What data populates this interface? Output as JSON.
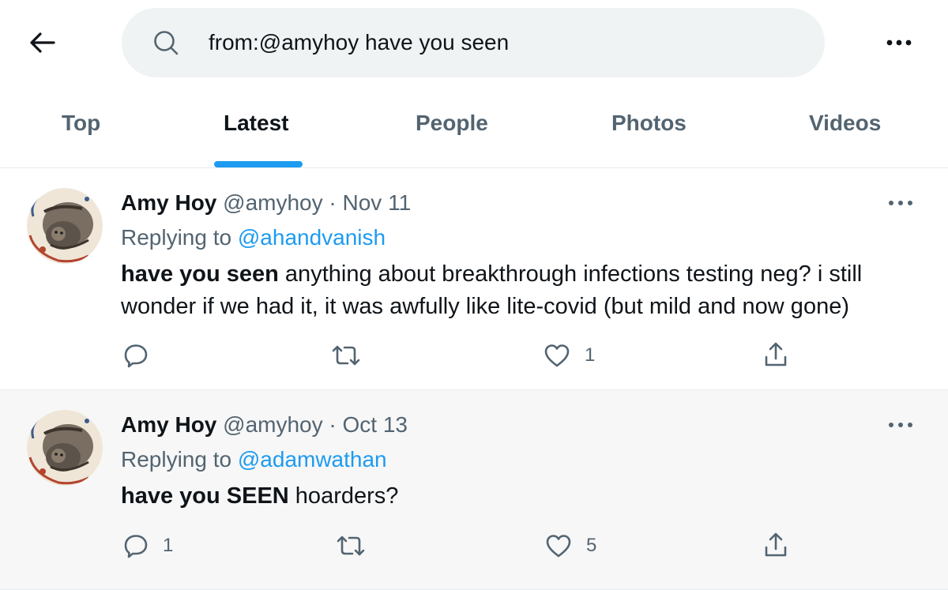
{
  "search": {
    "query": "from:@amyhoy have you seen",
    "back_icon": "arrow-left-icon",
    "search_icon": "magnifier-icon",
    "more_icon": "ellipsis-icon"
  },
  "tabs": [
    {
      "label": "Top",
      "active": false
    },
    {
      "label": "Latest",
      "active": true
    },
    {
      "label": "People",
      "active": false
    },
    {
      "label": "Photos",
      "active": false
    },
    {
      "label": "Videos",
      "active": false
    }
  ],
  "tweets": [
    {
      "name": "Amy Hoy",
      "handle": "@amyhoy",
      "separator": "·",
      "date": "Nov 11",
      "replying_prefix": "Replying to",
      "replying_to": "@ahandvanish",
      "text_bold": "have you seen",
      "text_rest": " anything about breakthrough infections testing neg? i still wonder if we had it, it was awfully like lite-covid (but mild and now gone)",
      "reply_count": "",
      "retweet_count": "",
      "like_count": "1"
    },
    {
      "name": "Amy Hoy",
      "handle": "@amyhoy",
      "separator": "·",
      "date": "Oct 13",
      "replying_prefix": "Replying to",
      "replying_to": "@adamwathan",
      "text_bold": "have you SEEN",
      "text_rest": " hoarders?",
      "reply_count": "1",
      "retweet_count": "",
      "like_count": "5"
    }
  ],
  "colors": {
    "accent": "#1d9bf0",
    "text_primary": "#0f1419",
    "text_secondary": "#536471",
    "search_bg": "#eff3f4"
  }
}
